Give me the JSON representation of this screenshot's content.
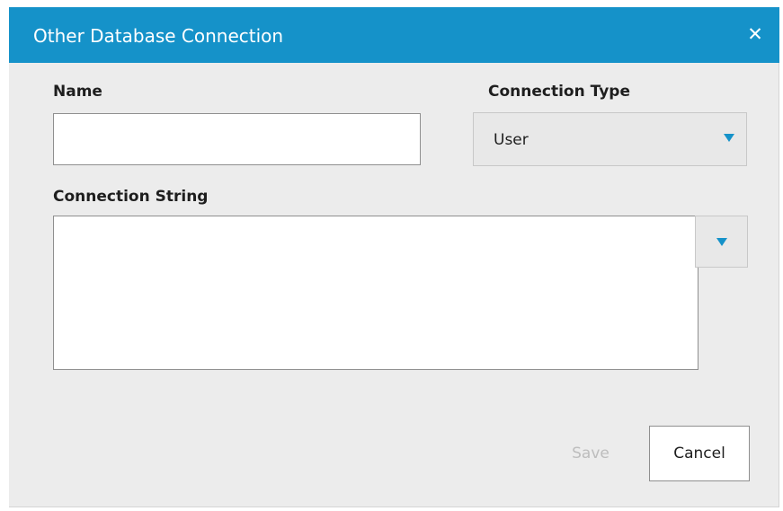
{
  "dialog": {
    "title": "Other Database Connection",
    "close_icon": "close-icon",
    "accent_color": "#1592c9"
  },
  "form": {
    "name_label": "Name",
    "name_value": "",
    "connection_type_label": "Connection Type",
    "connection_type_value": "User",
    "connection_string_label": "Connection String",
    "connection_string_value": ""
  },
  "footer": {
    "save_label": "Save",
    "save_enabled": false,
    "cancel_label": "Cancel"
  }
}
